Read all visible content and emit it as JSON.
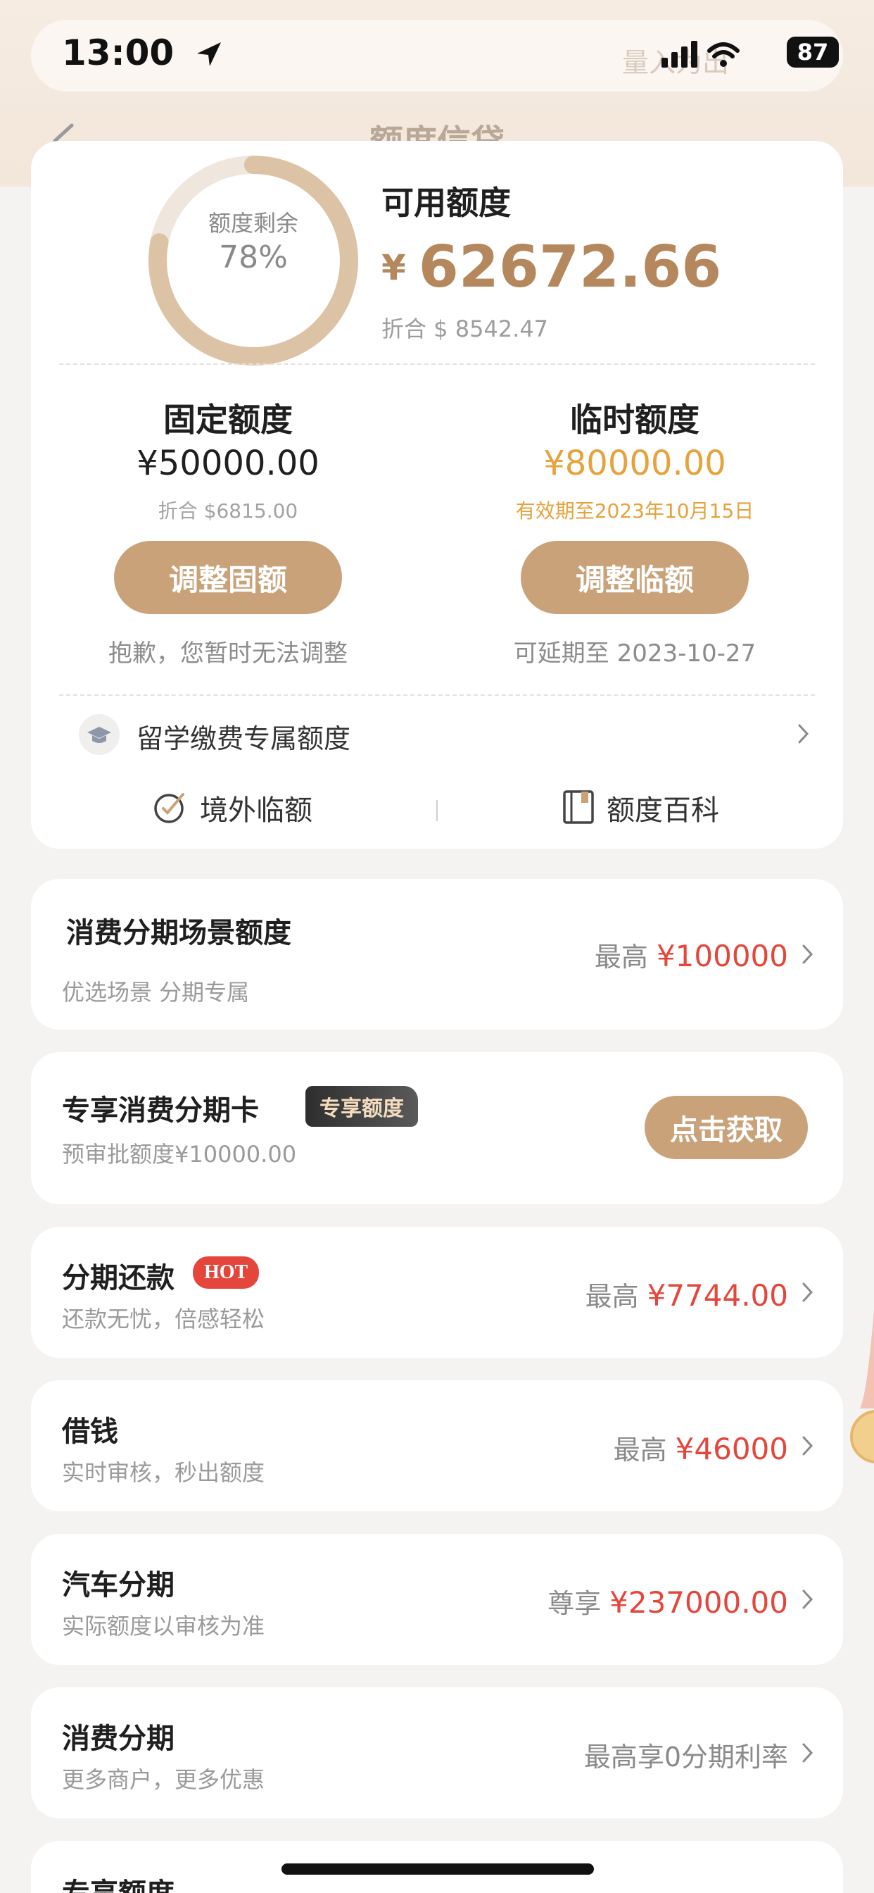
{
  "status": {
    "time": "13:00",
    "battery": "87",
    "ghost_text": "量入为出"
  },
  "nav": {
    "title": "额度信贷"
  },
  "summary": {
    "ring_label": "额度剩余",
    "ring_value": "78%",
    "ring_fraction": 0.78,
    "available_label": "可用额度",
    "available_currency": "¥",
    "available_amount": "62672.66",
    "available_converted": "折合 $ 8542.47"
  },
  "fixed_quota": {
    "title": "固定额度",
    "amount": "¥50000.00",
    "converted": "折合 $6815.00",
    "button": "调整固额",
    "note": "抱歉，您暂时无法调整"
  },
  "temp_quota": {
    "title": "临时额度",
    "amount": "¥80000.00",
    "validity": "有效期至2023年10月15日",
    "button": "调整临额",
    "note": "可延期至 2023-10-27"
  },
  "study_row": {
    "label": "留学缴费专属额度"
  },
  "bottom_links": [
    {
      "label": "境外临额",
      "icon": "overseas-icon"
    },
    {
      "label": "额度百科",
      "icon": "book-icon"
    }
  ],
  "scene_card": {
    "title": "消费分期场景额度",
    "subtitle": "优选场景 分期专属",
    "right_prefix": "最高",
    "right_value": "¥100000"
  },
  "exclusive_card": {
    "title": "专享消费分期卡",
    "badge": "专享额度",
    "subtitle": "预审批额度¥10000.00",
    "button": "点击获取"
  },
  "list_items": [
    {
      "title": "分期还款",
      "badge": "HOT",
      "subtitle": "还款无忧，倍感轻松",
      "prefix": "最高",
      "value": "¥7744.00"
    },
    {
      "title": "借钱",
      "badge": "",
      "subtitle": "实时审核，秒出额度",
      "prefix": "最高",
      "value": "¥46000"
    },
    {
      "title": "汽车分期",
      "badge": "",
      "subtitle": "实际额度以审核为准",
      "prefix": "尊享",
      "value": "¥237000.00"
    },
    {
      "title": "消费分期",
      "badge": "",
      "subtitle": "更多商户，更多优惠",
      "prefix": "最高享0分期利率",
      "value": ""
    }
  ],
  "partial_card": {
    "title": "专享额度"
  },
  "colors": {
    "gold": "#b5875c",
    "button": "#c9a27a",
    "orange": "#e6a23c",
    "red": "#e5463c"
  }
}
